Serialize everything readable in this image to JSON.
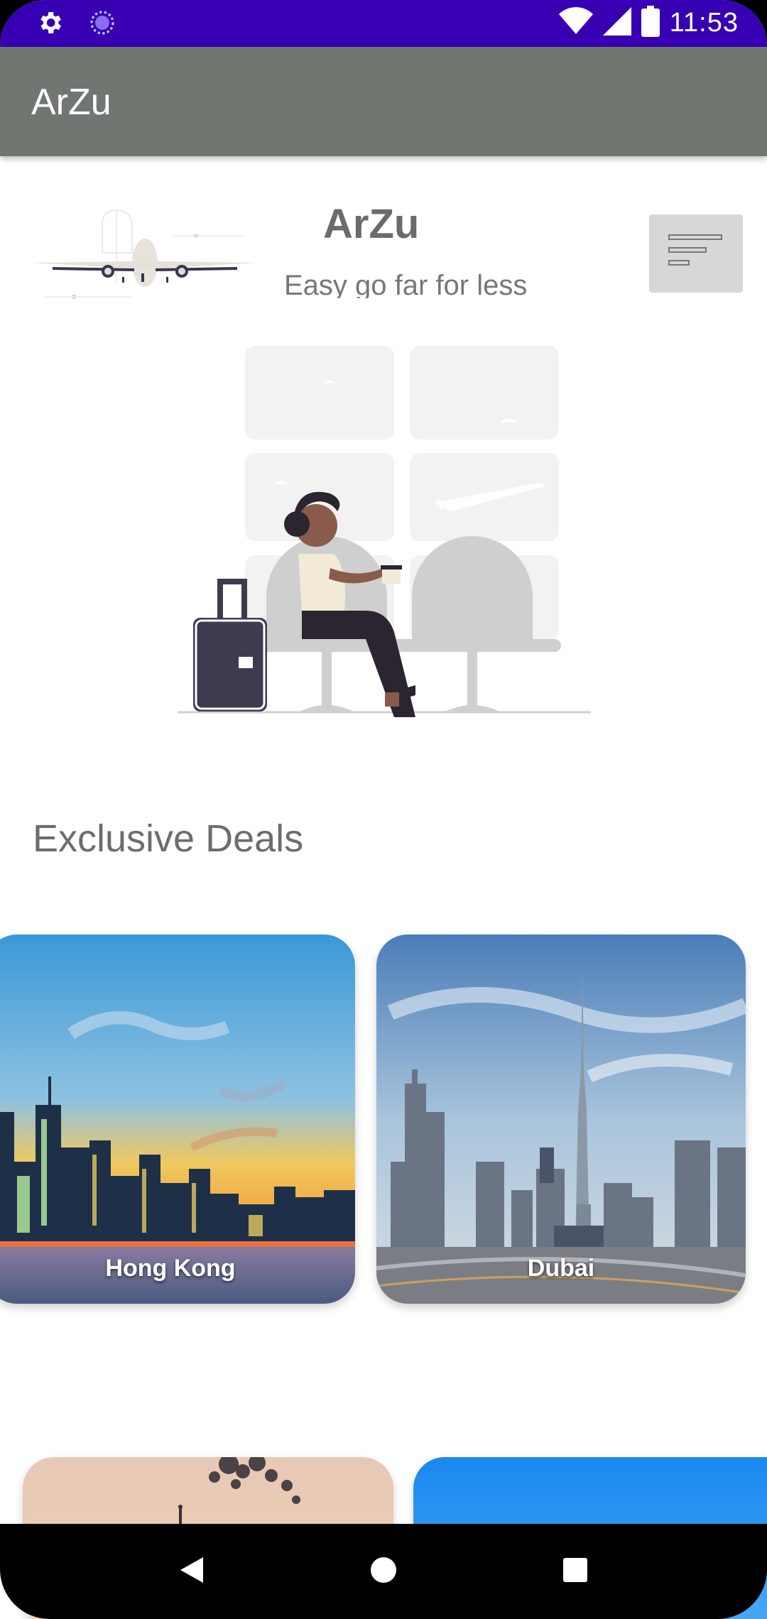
{
  "status_bar": {
    "time": "11:53",
    "icons_left": [
      "gear-icon",
      "circle-sync-icon"
    ],
    "icons_right": [
      "wifi-icon",
      "signal-icon",
      "battery-icon"
    ],
    "color": "#3700b3"
  },
  "app_bar": {
    "title": "ArZu",
    "color": "#6f7770"
  },
  "header": {
    "title": "ArZu",
    "subtitle": "Easy go far for less",
    "menu_icon": "filter-lines-icon"
  },
  "deals": {
    "title": "Exclusive Deals",
    "cards": [
      {
        "label": "Hong Kong"
      },
      {
        "label": "Dubai"
      },
      {
        "label": ""
      },
      {
        "label": ""
      }
    ]
  },
  "nav_bar": {
    "buttons": [
      "back-icon",
      "home-icon",
      "recents-icon"
    ]
  }
}
